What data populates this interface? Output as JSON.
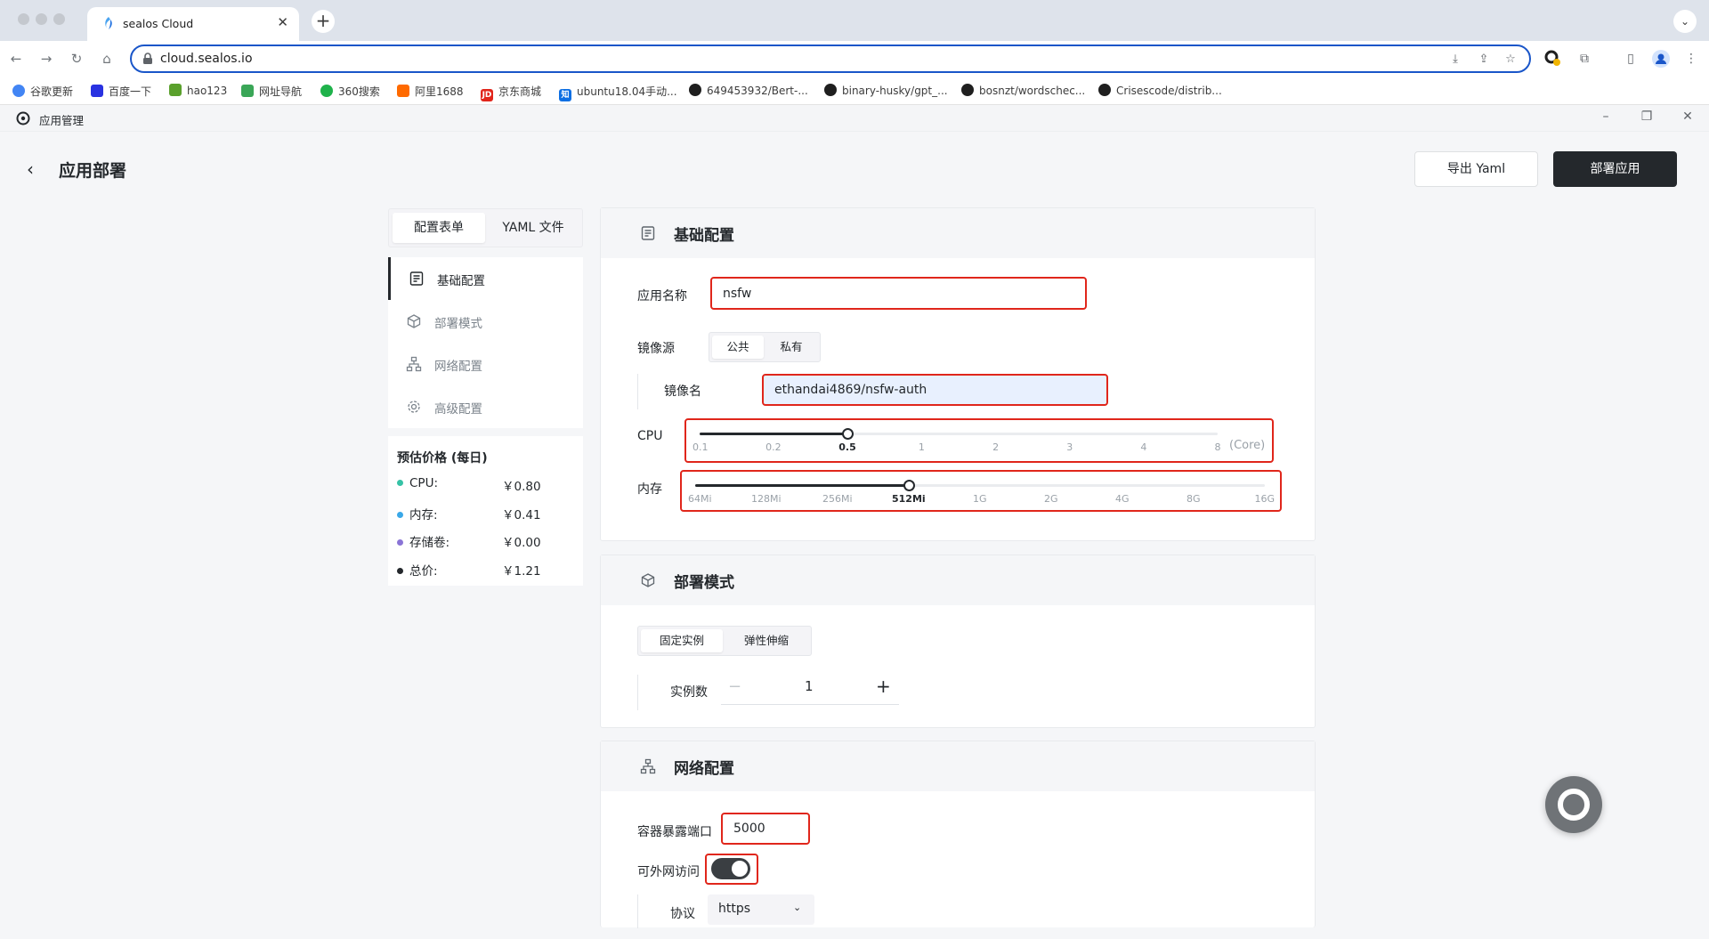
{
  "browser": {
    "tab_title": "sealos Cloud",
    "url": "cloud.sealos.io",
    "extension_badge": "3"
  },
  "bookmarks": [
    {
      "label": "谷歌更新",
      "color": "#4285f4"
    },
    {
      "label": "百度一下",
      "color": "#2932e1"
    },
    {
      "label": "hao123",
      "color": "#5aa02c"
    },
    {
      "label": "网址导航",
      "color": "#3aa657"
    },
    {
      "label": "360搜索",
      "color": "#1fb24b"
    },
    {
      "label": "阿里1688",
      "color": "#ff6a00"
    },
    {
      "label": "京东商城",
      "color": "#e1251b"
    },
    {
      "label": "ubuntu18.04手动...",
      "color": "#0e6fe3"
    },
    {
      "label": "649453932/Bert-...",
      "color": "#1f1f1f"
    },
    {
      "label": "binary-husky/gpt_...",
      "color": "#1f1f1f"
    },
    {
      "label": "bosnzt/wordschec...",
      "color": "#1f1f1f"
    },
    {
      "label": "Crisescode/distrib...",
      "color": "#1f1f1f"
    }
  ],
  "app": {
    "window_title": "应用管理",
    "page_title": "应用部署",
    "export_label": "导出 Yaml",
    "deploy_label": "部署应用"
  },
  "left": {
    "mode_tabs": [
      "配置表单",
      "YAML 文件"
    ],
    "nav": [
      "基础配置",
      "部署模式",
      "网络配置",
      "高级配置"
    ],
    "price_title": "预估价格 (每日)",
    "prices": [
      {
        "label": "CPU:",
        "value": "￥0.80",
        "color": "#36c2a6"
      },
      {
        "label": "内存:",
        "value": "￥0.41",
        "color": "#3aa8e8"
      },
      {
        "label": "存储卷:",
        "value": "￥0.00",
        "color": "#8a74d6"
      },
      {
        "label": "总价:",
        "value": "￥1.21",
        "color": "#24282c"
      }
    ]
  },
  "basic": {
    "title": "基础配置",
    "app_name_label": "应用名称",
    "app_name_value": "nsfw",
    "image_source_label": "镜像源",
    "image_source_options": [
      "公共",
      "私有"
    ],
    "image_source_selected": "公共",
    "image_name_label": "镜像名",
    "image_name_value": "ethandai4869/nsfw-auth",
    "cpu_label": "CPU",
    "cpu_ticks": [
      "0.1",
      "0.2",
      "0.5",
      "1",
      "2",
      "3",
      "4",
      "8"
    ],
    "cpu_selected": "0.5",
    "cpu_unit": "(Core)",
    "mem_label": "内存",
    "mem_ticks": [
      "64Mi",
      "128Mi",
      "256Mi",
      "512Mi",
      "1G",
      "2G",
      "4G",
      "8G",
      "16G"
    ],
    "mem_selected": "512Mi"
  },
  "deploy_mode": {
    "title": "部署模式",
    "options": [
      "固定实例",
      "弹性伸缩"
    ],
    "selected": "固定实例",
    "instances_label": "实例数",
    "instances_value": "1",
    "minus": "−",
    "plus": "+"
  },
  "network": {
    "title": "网络配置",
    "port_label": "容器暴露端口",
    "port_value": "5000",
    "public_label": "可外网访问",
    "public_enabled": true,
    "protocol_label": "协议",
    "protocol_value": "https"
  }
}
